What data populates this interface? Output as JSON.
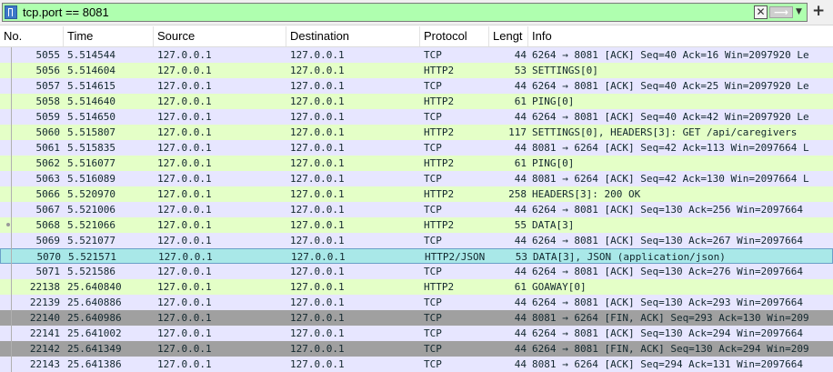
{
  "filter": {
    "text": "tcp.port == 8081",
    "bg": "#afffaf"
  },
  "columns": [
    "No.",
    "Time",
    "Source",
    "Destination",
    "Protocol",
    "Lengt",
    "Info"
  ],
  "colors": {
    "tcp": "#e7e6ff",
    "http2": "#e4ffc7",
    "fin": "#a0a0a0",
    "selected": "#a9e8e8"
  },
  "rows": [
    {
      "no": "5055",
      "time": "5.514544",
      "src": "127.0.0.1",
      "dst": "127.0.0.1",
      "proto": "TCP",
      "len": "44",
      "info": "6264 → 8081 [ACK] Seq=40 Ack=16 Win=2097920 Le",
      "style": "tcp"
    },
    {
      "no": "5056",
      "time": "5.514604",
      "src": "127.0.0.1",
      "dst": "127.0.0.1",
      "proto": "HTTP2",
      "len": "53",
      "info": "SETTINGS[0]",
      "style": "http2"
    },
    {
      "no": "5057",
      "time": "5.514615",
      "src": "127.0.0.1",
      "dst": "127.0.0.1",
      "proto": "TCP",
      "len": "44",
      "info": "6264 → 8081 [ACK] Seq=40 Ack=25 Win=2097920 Le",
      "style": "tcp"
    },
    {
      "no": "5058",
      "time": "5.514640",
      "src": "127.0.0.1",
      "dst": "127.0.0.1",
      "proto": "HTTP2",
      "len": "61",
      "info": "PING[0]",
      "style": "http2"
    },
    {
      "no": "5059",
      "time": "5.514650",
      "src": "127.0.0.1",
      "dst": "127.0.0.1",
      "proto": "TCP",
      "len": "44",
      "info": "6264 → 8081 [ACK] Seq=40 Ack=42 Win=2097920 Le",
      "style": "tcp"
    },
    {
      "no": "5060",
      "time": "5.515807",
      "src": "127.0.0.1",
      "dst": "127.0.0.1",
      "proto": "HTTP2",
      "len": "117",
      "info": "SETTINGS[0], HEADERS[3]: GET /api/caregivers",
      "style": "http2"
    },
    {
      "no": "5061",
      "time": "5.515835",
      "src": "127.0.0.1",
      "dst": "127.0.0.1",
      "proto": "TCP",
      "len": "44",
      "info": "8081 → 6264 [ACK] Seq=42 Ack=113 Win=2097664 L",
      "style": "tcp"
    },
    {
      "no": "5062",
      "time": "5.516077",
      "src": "127.0.0.1",
      "dst": "127.0.0.1",
      "proto": "HTTP2",
      "len": "61",
      "info": "PING[0]",
      "style": "http2"
    },
    {
      "no": "5063",
      "time": "5.516089",
      "src": "127.0.0.1",
      "dst": "127.0.0.1",
      "proto": "TCP",
      "len": "44",
      "info": "8081 → 6264 [ACK] Seq=42 Ack=130 Win=2097664 L",
      "style": "tcp"
    },
    {
      "no": "5066",
      "time": "5.520970",
      "src": "127.0.0.1",
      "dst": "127.0.0.1",
      "proto": "HTTP2",
      "len": "258",
      "info": "HEADERS[3]: 200 OK",
      "style": "http2"
    },
    {
      "no": "5067",
      "time": "5.521006",
      "src": "127.0.0.1",
      "dst": "127.0.0.1",
      "proto": "TCP",
      "len": "44",
      "info": "6264 → 8081 [ACK] Seq=130 Ack=256 Win=2097664",
      "style": "tcp"
    },
    {
      "no": "5068",
      "time": "5.521066",
      "src": "127.0.0.1",
      "dst": "127.0.0.1",
      "proto": "HTTP2",
      "len": "55",
      "info": "DATA[3]",
      "style": "http2"
    },
    {
      "no": "5069",
      "time": "5.521077",
      "src": "127.0.0.1",
      "dst": "127.0.0.1",
      "proto": "TCP",
      "len": "44",
      "info": "6264 → 8081 [ACK] Seq=130 Ack=267 Win=2097664",
      "style": "tcp"
    },
    {
      "no": "5070",
      "time": "5.521571",
      "src": "127.0.0.1",
      "dst": "127.0.0.1",
      "proto": "HTTP2/JSON",
      "len": "53",
      "info": "DATA[3], JSON (application/json)",
      "style": "selected"
    },
    {
      "no": "5071",
      "time": "5.521586",
      "src": "127.0.0.1",
      "dst": "127.0.0.1",
      "proto": "TCP",
      "len": "44",
      "info": "6264 → 8081 [ACK] Seq=130 Ack=276 Win=2097664",
      "style": "tcp"
    },
    {
      "no": "22138",
      "time": "25.640840",
      "src": "127.0.0.1",
      "dst": "127.0.0.1",
      "proto": "HTTP2",
      "len": "61",
      "info": "GOAWAY[0]",
      "style": "http2"
    },
    {
      "no": "22139",
      "time": "25.640886",
      "src": "127.0.0.1",
      "dst": "127.0.0.1",
      "proto": "TCP",
      "len": "44",
      "info": "6264 → 8081 [ACK] Seq=130 Ack=293 Win=2097664",
      "style": "tcp"
    },
    {
      "no": "22140",
      "time": "25.640986",
      "src": "127.0.0.1",
      "dst": "127.0.0.1",
      "proto": "TCP",
      "len": "44",
      "info": "8081 → 6264 [FIN, ACK] Seq=293 Ack=130 Win=209",
      "style": "fin"
    },
    {
      "no": "22141",
      "time": "25.641002",
      "src": "127.0.0.1",
      "dst": "127.0.0.1",
      "proto": "TCP",
      "len": "44",
      "info": "6264 → 8081 [ACK] Seq=130 Ack=294 Win=2097664",
      "style": "tcp"
    },
    {
      "no": "22142",
      "time": "25.641349",
      "src": "127.0.0.1",
      "dst": "127.0.0.1",
      "proto": "TCP",
      "len": "44",
      "info": "6264 → 8081 [FIN, ACK] Seq=130 Ack=294 Win=209",
      "style": "fin"
    },
    {
      "no": "22143",
      "time": "25.641386",
      "src": "127.0.0.1",
      "dst": "127.0.0.1",
      "proto": "TCP",
      "len": "44",
      "info": "8081 → 6264 [ACK] Seq=294 Ack=131 Win=2097664",
      "style": "tcp"
    }
  ]
}
